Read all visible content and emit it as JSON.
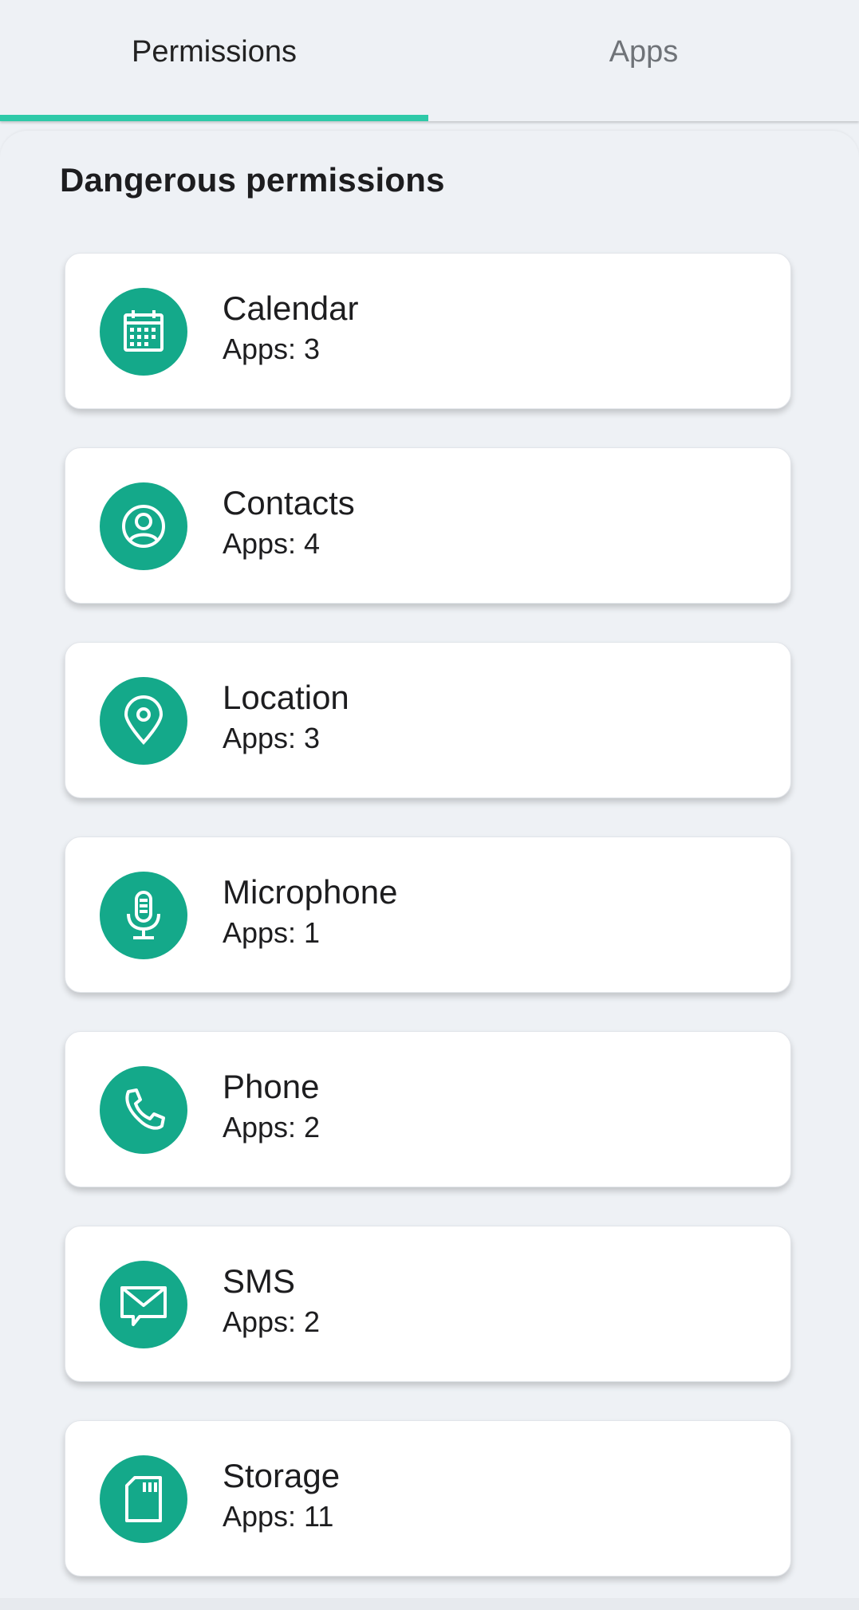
{
  "tabs": [
    {
      "label": "Permissions",
      "selected": true
    },
    {
      "label": "Apps",
      "selected": false
    }
  ],
  "section_title": "Dangerous permissions",
  "colors": {
    "accent": "#2ec9a8",
    "icon_bg": "#14a98a",
    "background": "#eef1f5",
    "card": "#ffffff"
  },
  "permissions": [
    {
      "name": "Calendar",
      "apps": "Apps: 3",
      "icon": "calendar-icon"
    },
    {
      "name": "Contacts",
      "apps": "Apps: 4",
      "icon": "contact-icon"
    },
    {
      "name": "Location",
      "apps": "Apps: 3",
      "icon": "location-pin-icon"
    },
    {
      "name": "Microphone",
      "apps": "Apps: 1",
      "icon": "microphone-icon"
    },
    {
      "name": "Phone",
      "apps": "Apps: 2",
      "icon": "phone-icon"
    },
    {
      "name": "SMS",
      "apps": "Apps: 2",
      "icon": "message-icon"
    },
    {
      "name": "Storage",
      "apps": "Apps: 11",
      "icon": "sd-card-icon"
    }
  ]
}
